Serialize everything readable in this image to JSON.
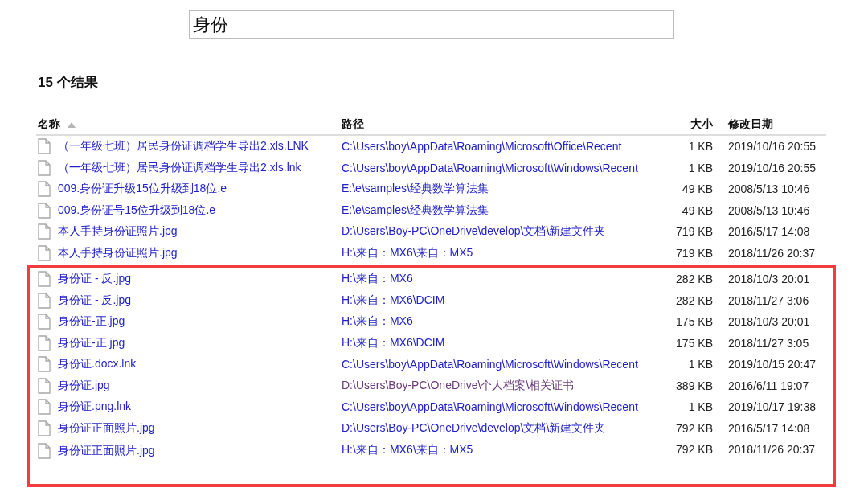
{
  "search": {
    "value": "身份"
  },
  "results_heading": "15 个结果",
  "table": {
    "columns": [
      {
        "label": "名称",
        "sorted": true
      },
      {
        "label": "路径",
        "sorted": false
      },
      {
        "label": "大小",
        "sorted": false
      },
      {
        "label": "修改日期",
        "sorted": false
      }
    ],
    "rows": [
      {
        "name": "（一年级七班）居民身份证调档学生导出2.xls.LNK",
        "path": "C:\\Users\\boy\\AppData\\Roaming\\Microsoft\\Office\\Recent",
        "visited": false,
        "size": "1 KB",
        "modified": "2019/10/16 20:55",
        "highlighted": false
      },
      {
        "name": "（一年级七班）居民身份证调档学生导出2.xls.lnk",
        "path": "C:\\Users\\boy\\AppData\\Roaming\\Microsoft\\Windows\\Recent",
        "visited": false,
        "size": "1 KB",
        "modified": "2019/10/16 20:55",
        "highlighted": false
      },
      {
        "name": "009.身份证升级15位升级到18位.e",
        "path": "E:\\e\\samples\\经典数学算法集",
        "visited": false,
        "size": "49 KB",
        "modified": "2008/5/13 10:46",
        "highlighted": false
      },
      {
        "name": "009.身份证号15位升级到18位.e",
        "path": "E:\\e\\samples\\经典数学算法集",
        "visited": false,
        "size": "49 KB",
        "modified": "2008/5/13 10:46",
        "highlighted": false
      },
      {
        "name": "本人手持身份证照片.jpg",
        "path": "D:\\Users\\Boy-PC\\OneDrive\\develop\\文档\\新建文件夹",
        "visited": false,
        "size": "719 KB",
        "modified": "2016/5/17 14:08",
        "highlighted": false
      },
      {
        "name": "本人手持身份证照片.jpg",
        "path": "H:\\来自：MX6\\来自：MX5",
        "visited": false,
        "size": "719 KB",
        "modified": "2018/11/26 20:37",
        "highlighted": false
      },
      {
        "name": "身份证 - 反.jpg",
        "path": "H:\\来自：MX6",
        "visited": false,
        "size": "282 KB",
        "modified": "2018/10/3 20:01",
        "highlighted": true
      },
      {
        "name": "身份证 - 反.jpg",
        "path": "H:\\来自：MX6\\DCIM",
        "visited": false,
        "size": "282 KB",
        "modified": "2018/11/27 3:06",
        "highlighted": true
      },
      {
        "name": "身份证-正.jpg",
        "path": "H:\\来自：MX6",
        "visited": false,
        "size": "175 KB",
        "modified": "2018/10/3 20:01",
        "highlighted": true
      },
      {
        "name": "身份证-正.jpg",
        "path": "H:\\来自：MX6\\DCIM",
        "visited": false,
        "size": "175 KB",
        "modified": "2018/11/27 3:05",
        "highlighted": true
      },
      {
        "name": "身份证.docx.lnk",
        "path": "C:\\Users\\boy\\AppData\\Roaming\\Microsoft\\Windows\\Recent",
        "visited": false,
        "size": "1 KB",
        "modified": "2019/10/15 20:47",
        "highlighted": true
      },
      {
        "name": "身份证.jpg",
        "path": "D:\\Users\\Boy-PC\\OneDrive\\个人档案\\相关证书",
        "visited": true,
        "size": "389 KB",
        "modified": "2016/6/11 19:07",
        "highlighted": true
      },
      {
        "name": "身份证.png.lnk",
        "path": "C:\\Users\\boy\\AppData\\Roaming\\Microsoft\\Windows\\Recent",
        "visited": false,
        "size": "1 KB",
        "modified": "2019/10/17 19:38",
        "highlighted": true
      },
      {
        "name": "身份证正面照片.jpg",
        "path": "D:\\Users\\Boy-PC\\OneDrive\\develop\\文档\\新建文件夹",
        "visited": false,
        "size": "792 KB",
        "modified": "2016/5/17 14:08",
        "highlighted": true
      },
      {
        "name": "身份证正面照片.jpg",
        "path": "H:\\来自：MX6\\来自：MX5",
        "visited": false,
        "size": "792 KB",
        "modified": "2018/11/26 20:37",
        "highlighted": true
      }
    ]
  }
}
